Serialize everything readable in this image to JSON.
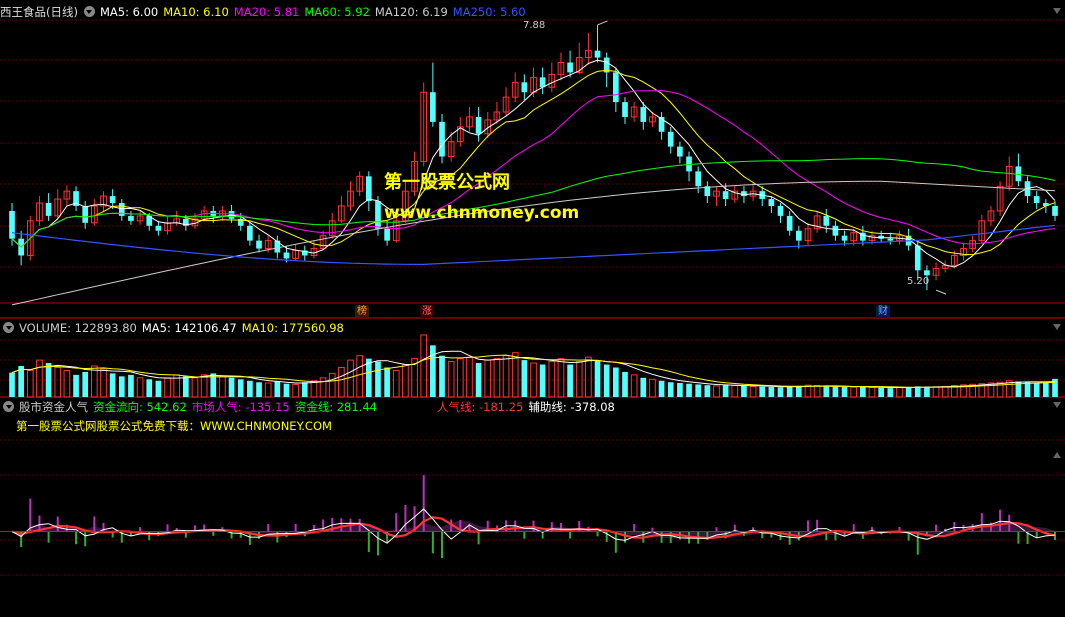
{
  "main_header": {
    "title": "西王食品(日线)",
    "items": [
      {
        "text": "MA5: 6.00",
        "color": "#ffffff"
      },
      {
        "text": "MA10: 6.10",
        "color": "#ffff00"
      },
      {
        "text": "MA20: 5.81",
        "color": "#ff00ff"
      },
      {
        "text": "MA60: 5.92",
        "color": "#00ff00"
      },
      {
        "text": "MA120: 6.19",
        "color": "#cccccc"
      },
      {
        "text": "MA250: 5.60",
        "color": "#3355ff"
      }
    ]
  },
  "volume_header": {
    "items": [
      {
        "text": "VOLUME: 122893.80",
        "color": "#cccccc"
      },
      {
        "text": "MA5: 142106.47",
        "color": "#ffffff"
      },
      {
        "text": "MA10: 177560.98",
        "color": "#ffff00"
      }
    ]
  },
  "indicator_header": {
    "title": "股市资金人气",
    "items": [
      {
        "text": "资金流向: 542.62",
        "color": "#00ff00"
      },
      {
        "text": "市场人气: -135.15",
        "color": "#ff00ff"
      },
      {
        "text": "资金线: 281.44",
        "color": "#00ff00"
      },
      {
        "text": "人气线: -181.25",
        "color": "#ff3333"
      },
      {
        "text": "辅助线: -378.08",
        "color": "#ffffff"
      }
    ],
    "subtitle": "第一股票公式网股票公式免费下载：WWW.CHNMONEY.COM"
  },
  "watermark": {
    "line1": "第一股票公式网",
    "line2": "www.chnmoney.com"
  },
  "markers": {
    "high": "7.88",
    "low": "5.20"
  },
  "event_tags": [
    {
      "label": "榜",
      "color": "#ff9933"
    },
    {
      "label": "涨",
      "color": "#ff6666"
    },
    {
      "label": "财",
      "color": "#66aaff"
    }
  ],
  "colors": {
    "up": "#ff3333",
    "down": "#54ffff",
    "grid": "#7a0000"
  },
  "chart_data": [
    {
      "type": "candlestick",
      "title": "西王食品(日线)",
      "price_range": [
        5.1,
        7.95
      ],
      "series": [
        {
          "name": "MA5",
          "color": "#ffffff"
        },
        {
          "name": "MA10",
          "color": "#ffff00"
        },
        {
          "name": "MA20",
          "color": "#ff00ff"
        },
        {
          "name": "MA60",
          "color": "#00ff00"
        },
        {
          "name": "MA120",
          "color": "#cccccc"
        },
        {
          "name": "MA250",
          "color": "#3355ff"
        }
      ],
      "candles": [
        [
          6.0,
          5.72,
          6.08,
          5.65
        ],
        [
          5.72,
          5.55,
          5.8,
          5.45
        ],
        [
          5.55,
          5.9,
          5.95,
          5.5
        ],
        [
          5.9,
          6.08,
          6.15,
          5.85
        ],
        [
          6.08,
          5.95,
          6.18,
          5.9
        ],
        [
          5.95,
          6.12,
          6.22,
          5.92
        ],
        [
          6.12,
          6.2,
          6.26,
          6.05
        ],
        [
          6.2,
          6.05,
          6.25,
          6.0
        ],
        [
          6.05,
          5.88,
          6.1,
          5.82
        ],
        [
          5.88,
          6.05,
          6.12,
          5.85
        ],
        [
          6.05,
          6.15,
          6.2,
          6.0
        ],
        [
          6.15,
          6.08,
          6.22,
          6.02
        ],
        [
          6.08,
          5.95,
          6.12,
          5.9
        ],
        [
          5.95,
          5.9,
          6.0,
          5.86
        ],
        [
          5.9,
          5.95,
          6.0,
          5.86
        ],
        [
          5.95,
          5.85,
          5.98,
          5.8
        ],
        [
          5.85,
          5.8,
          5.9,
          5.75
        ],
        [
          5.8,
          5.88,
          5.95,
          5.76
        ],
        [
          5.88,
          5.92,
          6.0,
          5.85
        ],
        [
          5.92,
          5.85,
          5.96,
          5.8
        ],
        [
          5.85,
          5.92,
          5.98,
          5.82
        ],
        [
          5.92,
          6.0,
          6.05,
          5.9
        ],
        [
          6.0,
          5.95,
          6.05,
          5.88
        ],
        [
          5.95,
          6.0,
          6.05,
          5.9
        ],
        [
          6.0,
          5.92,
          6.06,
          5.88
        ],
        [
          5.92,
          5.85,
          5.98,
          5.8
        ],
        [
          5.85,
          5.7,
          5.88,
          5.65
        ],
        [
          5.7,
          5.62,
          5.76,
          5.58
        ],
        [
          5.62,
          5.7,
          5.75,
          5.58
        ],
        [
          5.7,
          5.58,
          5.75,
          5.52
        ],
        [
          5.58,
          5.52,
          5.65,
          5.48
        ],
        [
          5.52,
          5.6,
          5.66,
          5.5
        ],
        [
          5.6,
          5.55,
          5.65,
          5.5
        ],
        [
          5.55,
          5.62,
          5.7,
          5.52
        ],
        [
          5.62,
          5.75,
          5.8,
          5.6
        ],
        [
          5.75,
          5.9,
          5.98,
          5.72
        ],
        [
          5.9,
          6.05,
          6.15,
          5.88
        ],
        [
          6.05,
          6.2,
          6.3,
          6.0
        ],
        [
          6.2,
          6.35,
          6.4,
          6.15
        ],
        [
          6.35,
          6.1,
          6.4,
          6.0
        ],
        [
          6.1,
          5.82,
          6.15,
          5.75
        ],
        [
          5.82,
          5.7,
          5.9,
          5.65
        ],
        [
          5.7,
          5.9,
          5.98,
          5.68
        ],
        [
          5.9,
          6.2,
          6.3,
          5.88
        ],
        [
          6.2,
          6.5,
          6.6,
          6.15
        ],
        [
          6.5,
          7.2,
          7.3,
          6.45
        ],
        [
          7.2,
          6.9,
          7.5,
          6.85
        ],
        [
          6.9,
          6.55,
          6.98,
          6.48
        ],
        [
          6.55,
          6.7,
          6.8,
          6.5
        ],
        [
          6.7,
          6.85,
          6.95,
          6.65
        ],
        [
          6.85,
          6.95,
          7.05,
          6.8
        ],
        [
          6.95,
          6.78,
          7.05,
          6.7
        ],
        [
          6.78,
          6.92,
          7.0,
          6.74
        ],
        [
          6.92,
          7.0,
          7.1,
          6.88
        ],
        [
          7.0,
          7.15,
          7.25,
          6.95
        ],
        [
          7.15,
          7.3,
          7.4,
          7.1
        ],
        [
          7.3,
          7.2,
          7.38,
          7.12
        ],
        [
          7.2,
          7.35,
          7.45,
          7.15
        ],
        [
          7.35,
          7.25,
          7.45,
          7.18
        ],
        [
          7.25,
          7.38,
          7.5,
          7.2
        ],
        [
          7.38,
          7.5,
          7.6,
          7.32
        ],
        [
          7.5,
          7.4,
          7.62,
          7.35
        ],
        [
          7.4,
          7.55,
          7.7,
          7.38
        ],
        [
          7.55,
          7.62,
          7.8,
          7.48
        ],
        [
          7.62,
          7.55,
          7.88,
          7.5
        ],
        [
          7.55,
          7.4,
          7.6,
          7.25
        ],
        [
          7.4,
          7.1,
          7.45,
          7.0
        ],
        [
          7.1,
          6.95,
          7.15,
          6.88
        ],
        [
          6.95,
          7.05,
          7.1,
          6.9
        ],
        [
          7.05,
          6.9,
          7.1,
          6.82
        ],
        [
          6.9,
          6.95,
          7.0,
          6.85
        ],
        [
          6.95,
          6.8,
          7.0,
          6.72
        ],
        [
          6.8,
          6.65,
          6.85,
          6.58
        ],
        [
          6.65,
          6.55,
          6.7,
          6.48
        ],
        [
          6.55,
          6.4,
          6.6,
          6.3
        ],
        [
          6.4,
          6.25,
          6.45,
          6.18
        ],
        [
          6.25,
          6.15,
          6.3,
          6.08
        ],
        [
          6.15,
          6.2,
          6.25,
          6.05
        ],
        [
          6.2,
          6.12,
          6.28,
          6.05
        ],
        [
          6.12,
          6.2,
          6.26,
          6.08
        ],
        [
          6.2,
          6.15,
          6.25,
          6.08
        ],
        [
          6.15,
          6.2,
          6.28,
          6.1
        ],
        [
          6.2,
          6.12,
          6.25,
          6.05
        ],
        [
          6.12,
          6.05,
          6.15,
          5.98
        ],
        [
          6.05,
          5.95,
          6.08,
          5.88
        ],
        [
          5.95,
          5.8,
          6.0,
          5.75
        ],
        [
          5.8,
          5.7,
          5.85,
          5.62
        ],
        [
          5.7,
          5.82,
          5.88,
          5.65
        ],
        [
          5.82,
          5.95,
          6.0,
          5.78
        ],
        [
          5.95,
          5.85,
          6.02,
          5.78
        ],
        [
          5.85,
          5.75,
          5.9,
          5.7
        ],
        [
          5.75,
          5.7,
          5.8,
          5.65
        ],
        [
          5.7,
          5.78,
          5.82,
          5.65
        ],
        [
          5.78,
          5.7,
          5.85,
          5.65
        ],
        [
          5.7,
          5.75,
          5.8,
          5.66
        ],
        [
          5.75,
          5.72,
          5.8,
          5.68
        ],
        [
          5.72,
          5.7,
          5.78,
          5.66
        ],
        [
          5.7,
          5.75,
          5.8,
          5.66
        ],
        [
          5.75,
          5.65,
          5.82,
          5.6
        ],
        [
          5.65,
          5.4,
          5.7,
          5.3
        ],
        [
          5.4,
          5.35,
          5.45,
          5.2
        ],
        [
          5.35,
          5.42,
          5.48,
          5.3
        ],
        [
          5.42,
          5.45,
          5.5,
          5.38
        ],
        [
          5.45,
          5.55,
          5.6,
          5.42
        ],
        [
          5.55,
          5.62,
          5.68,
          5.5
        ],
        [
          5.62,
          5.7,
          5.75,
          5.58
        ],
        [
          5.7,
          5.9,
          5.96,
          5.68
        ],
        [
          5.9,
          6.0,
          6.05,
          5.85
        ],
        [
          6.0,
          6.25,
          6.3,
          5.95
        ],
        [
          6.25,
          6.45,
          6.55,
          6.2
        ],
        [
          6.45,
          6.3,
          6.58,
          6.25
        ],
        [
          6.3,
          6.15,
          6.35,
          6.08
        ],
        [
          6.15,
          6.08,
          6.2,
          6.02
        ],
        [
          6.08,
          6.05,
          6.12,
          5.98
        ],
        [
          6.05,
          5.95,
          6.1,
          5.9
        ]
      ],
      "high_label": "7.88",
      "low_label": "5.20"
    },
    {
      "type": "bar",
      "title": "VOLUME",
      "value_range": [
        0,
        420000
      ],
      "values": [
        165000,
        210000,
        180000,
        250000,
        230000,
        200000,
        180000,
        150000,
        170000,
        210000,
        190000,
        160000,
        140000,
        150000,
        130000,
        120000,
        110000,
        130000,
        150000,
        140000,
        130000,
        150000,
        160000,
        140000,
        130000,
        120000,
        110000,
        100000,
        95000,
        105000,
        90000,
        85000,
        100000,
        110000,
        130000,
        160000,
        200000,
        250000,
        280000,
        260000,
        240000,
        200000,
        180000,
        220000,
        260000,
        420000,
        350000,
        280000,
        240000,
        260000,
        270000,
        230000,
        250000,
        260000,
        280000,
        300000,
        250000,
        230000,
        220000,
        240000,
        260000,
        220000,
        240000,
        270000,
        250000,
        220000,
        200000,
        170000,
        150000,
        130000,
        120000,
        110000,
        100000,
        95000,
        90000,
        85000,
        80000,
        75000,
        80000,
        78000,
        75000,
        72000,
        70000,
        68000,
        65000,
        70000,
        75000,
        80000,
        78000,
        72000,
        70000,
        68000,
        66000,
        70000,
        65000,
        62000,
        60000,
        64000,
        68000,
        72000,
        70000,
        68000,
        72000,
        78000,
        82000,
        86000,
        90000,
        95000,
        100000,
        110000,
        105000,
        100000,
        95000,
        100000,
        122893.8
      ],
      "series": [
        {
          "name": "MA5",
          "color": "#ffffff"
        },
        {
          "name": "MA10",
          "color": "#ffff00"
        }
      ]
    },
    {
      "type": "line",
      "title": "股市资金人气",
      "value_range": [
        -2400,
        2800
      ],
      "series": [
        {
          "name": "资金线",
          "color": "#00ff00"
        },
        {
          "name": "人气线",
          "color": "#ff3333"
        },
        {
          "name": "辅助线",
          "color": "#ffffff"
        },
        {
          "name": "资金流向",
          "color": "#00ff00"
        },
        {
          "name": "市场人气",
          "color": "#ff00ff"
        }
      ]
    }
  ]
}
